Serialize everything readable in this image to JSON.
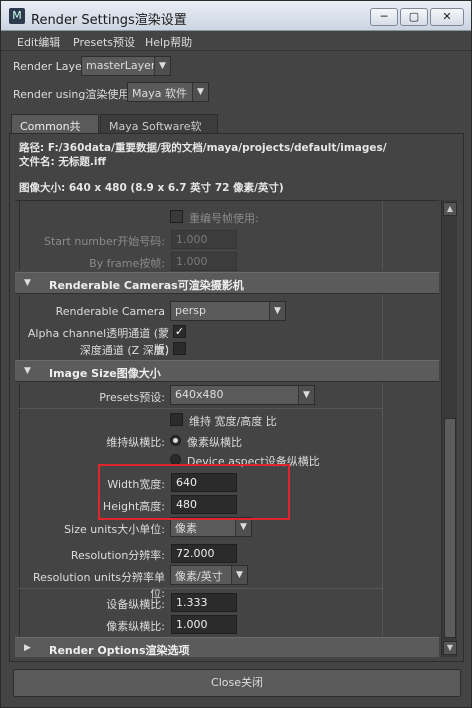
{
  "window": {
    "title": "Render Settings渲染设置",
    "btn_min": "─",
    "btn_max": "▢",
    "btn_close": "✕"
  },
  "menu": [
    "Edit编辑",
    "Presets预设",
    "Help帮助"
  ],
  "render_layer": {
    "label": "Render Layer",
    "value": "masterLayer"
  },
  "render_using": {
    "label": "Render using渲染使用:",
    "value": "Maya 软件"
  },
  "tabs": [
    {
      "label": "Common共用",
      "active": true
    },
    {
      "label": "Maya Software软件",
      "active": false
    }
  ],
  "info": {
    "path": "路径: F:/360data/重要数据/我的文档/maya/projects/default/images/",
    "filename": "文件名: 无标题.iff",
    "image_size": "图像大小: 640 x 480 (8.9 x 6.7 英寸 72 像素/英寸)"
  },
  "frame_numbering": {
    "renumber_label": "重编号帧使用:",
    "start_label": "Start number开始号码:",
    "start_value": "1.000",
    "by_frame_label": "By frame按帧:",
    "by_frame_value": "1.000"
  },
  "renderable_cameras": {
    "header": "Renderable Cameras可渲染摄影机",
    "camera_label": "Renderable Camera",
    "camera_value": "persp",
    "alpha_label": "Alpha channel透明通道 (蒙版)",
    "alpha_checked": true,
    "check_glyph": "✓",
    "depth_label": "深度通道 (Z 深度)",
    "depth_checked": false
  },
  "image_size": {
    "header": "Image Size图像大小",
    "presets_label": "Presets预设:",
    "presets_value": "640x480",
    "maintain_label": "维持 宽度/高度 比",
    "ratio_label": "维持纵横比:",
    "pixel_aspect_label": "像素纵横比",
    "device_aspect_label": "Device aspect设备纵横比",
    "width_label": "Width宽度:",
    "width_value": "640",
    "height_label": "Height高度:",
    "height_value": "480",
    "size_units_label": "Size units大小单位:",
    "size_units_value": "像素",
    "resolution_label": "Resolution分辨率:",
    "resolution_value": "72.000",
    "res_units_label": "Resolution units分辨率单位:",
    "res_units_value": "像素/英寸",
    "device_ratio_label": "设备纵横比:",
    "device_ratio_value": "1.333",
    "pixel_ratio_label": "像素纵横比:",
    "pixel_ratio_value": "1.000"
  },
  "render_options": {
    "header": "Render Options渲染选项"
  },
  "triangles": {
    "open": "▼",
    "closed": "▶"
  },
  "scrollbar": {
    "up": "▲",
    "down": "▼"
  },
  "dropdown_arrow": "▼",
  "close_button": "Close关闭",
  "colors": {
    "highlight": "#e0262a",
    "background": "#444444",
    "section": "#5b5b5b"
  }
}
